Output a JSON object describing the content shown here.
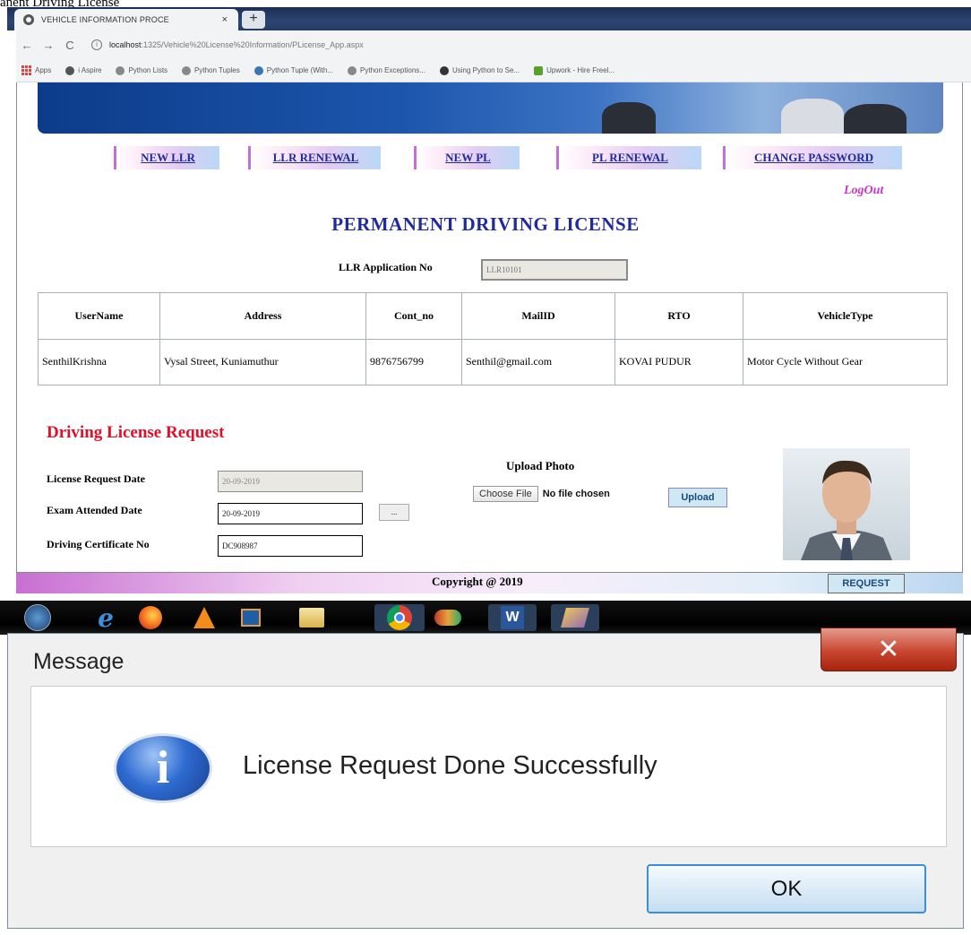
{
  "caption": "anent Driving License",
  "browser": {
    "tab_title": "VEHICLE INFORMATION PROCE",
    "tab_close": "×",
    "new_tab": "+",
    "url_host": "localhost",
    "url_path": ":1325/Vehicle%20License%20Information/PLicense_App.aspx",
    "bookmarks": [
      "Apps",
      "i Aspire",
      "Python Lists",
      "Python Tuples",
      "Python Tuple (With...",
      "Python Exceptions...",
      "Using Python to Se...",
      "Upwork - Hire Freel..."
    ]
  },
  "nav": {
    "new_llr": "NEW LLR",
    "llr_renewal": "LLR RENEWAL",
    "new_pl": "NEW PL",
    "pl_renewal": "PL RENEWAL",
    "change_password": "CHANGE PASSWORD",
    "logout": "LogOut"
  },
  "page_title": "PERMANENT DRIVING LICENSE",
  "llr": {
    "label": "LLR Application No",
    "value": "LLR10101"
  },
  "table": {
    "headers": [
      "UserName",
      "Address",
      "Cont_no",
      "MailID",
      "RTO",
      "VehicleType"
    ],
    "row": [
      "SenthilKrishna",
      "Vysal Street, Kuniamuthur",
      "9876756799",
      "Senthil@gmail.com",
      "KOVAI PUDUR",
      "Motor Cycle Without Gear"
    ]
  },
  "request": {
    "section_title": "Driving License Request",
    "license_request_date_label": "License Request Date",
    "license_request_date_value": "20-09-2019",
    "exam_attended_date_label": "Exam Attended Date",
    "exam_attended_date_value": "20-09-2019",
    "calendar_button": "...",
    "driving_certificate_label": "Driving Certificate No",
    "driving_certificate_value": "DC908987",
    "upload_title": "Upload Photo",
    "choose_file": "Choose File",
    "no_file": "No file chosen",
    "upload_button": "Upload"
  },
  "footer": {
    "copyright": "Copyright @ 2019",
    "request_button": "REQUEST"
  },
  "dialog": {
    "title": "Message",
    "message": "License Request Done Successfully",
    "ok": "OK",
    "close": "✕"
  },
  "colors": {
    "nav_text": "#1f2a9c",
    "section_red": "#e0102a",
    "logout_pink": "#cc33cc"
  }
}
